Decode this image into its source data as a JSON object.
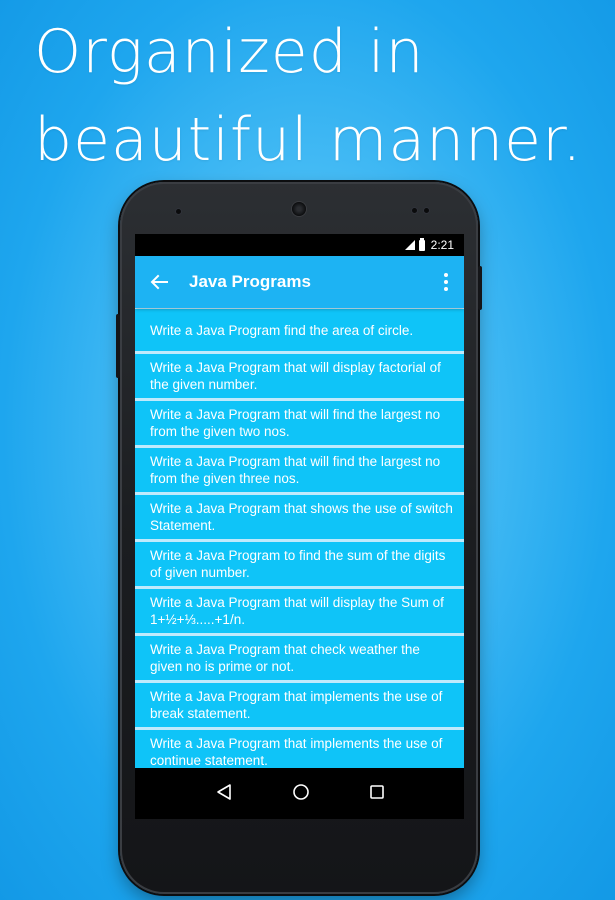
{
  "headline": {
    "line1": "Organized in",
    "line2": "beautiful manner."
  },
  "status_bar": {
    "time": "2:21"
  },
  "app_bar": {
    "title": "Java Programs",
    "back_icon": "arrow-left-icon",
    "menu_icon": "more-vert-icon"
  },
  "programs": [
    "Write a Java Program find the area of circle.",
    "Write a Java Program that will display factorial of the given number.",
    "Write a Java Program that will find the largest no from the given two nos.",
    "Write a Java Program that will find the largest no from the given three nos.",
    "Write a Java Program that shows the use of switch Statement.",
    "Write a Java Program to find the sum of the digits of given number.",
    "Write a Java Program that will display the Sum of 1+½+⅓.....+1/n.",
    "Write a Java Program that check weather the given no is prime or not.",
    "Write a Java Program that implements the use of break statement.",
    "Write a Java Program that implements the use of continue statement."
  ],
  "nav_bar": {
    "back": "nav-back-icon",
    "home": "nav-home-icon",
    "recents": "nav-recents-icon"
  },
  "colors": {
    "background": "#1ea6ee",
    "app_bar": "#1db3f3",
    "list_item": "#0fc4f8",
    "list_divider": "#bfeafc"
  }
}
